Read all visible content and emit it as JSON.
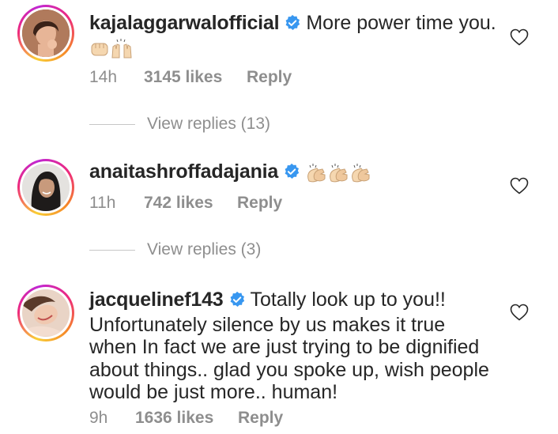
{
  "comments": [
    {
      "username": "kajalaggarwalofficial",
      "text": "More power time you.",
      "emoji_reactions": [
        "fist-emoji",
        "raising-hands-emoji"
      ],
      "time": "14h",
      "likes": "3145 likes",
      "reply_label": "Reply",
      "view_replies": "View replies (13)"
    },
    {
      "username": "anaitashroffadajania",
      "text": "",
      "emoji_reactions": [
        "clapping-hands-emoji",
        "clapping-hands-emoji",
        "clapping-hands-emoji"
      ],
      "time": "11h",
      "likes": "742 likes",
      "reply_label": "Reply",
      "view_replies": "View replies (3)"
    },
    {
      "username": "jacquelinef143",
      "text": "Totally look up to you!! Unfortunately silence by us makes it true when In fact we are just trying to be dignified about things.. glad you spoke up, wish people would be just more.. human!",
      "time": "9h",
      "likes": "1636 likes",
      "reply_label": "Reply"
    }
  ],
  "colors": {
    "text": "#262626",
    "meta": "#8e8e8e",
    "verified": "#3897f0",
    "divider": "#c7c7c7"
  },
  "icons": {
    "verified": "verified-badge-icon",
    "like": "heart-outline-icon"
  }
}
